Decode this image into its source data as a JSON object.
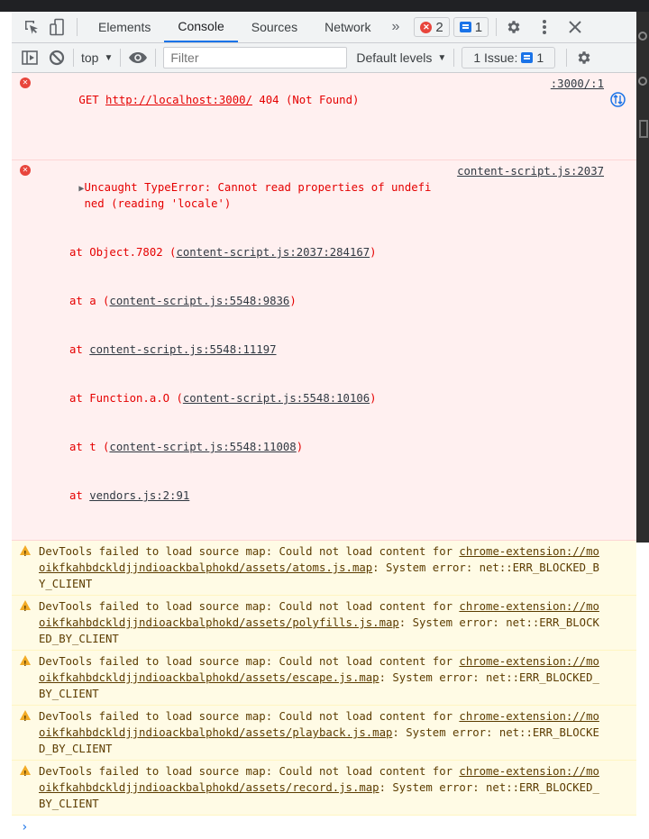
{
  "tabbar": {
    "tabs": [
      {
        "label": "Elements",
        "active": false
      },
      {
        "label": "Console",
        "active": true
      },
      {
        "label": "Sources",
        "active": false
      },
      {
        "label": "Network",
        "active": false
      }
    ],
    "more_tabs": "»",
    "error_count": "2",
    "message_count": "1"
  },
  "toolbar": {
    "context": "top",
    "filter_placeholder": "Filter",
    "levels": "Default levels",
    "issues_label": "1 Issue:",
    "issues_count": "1"
  },
  "messages": [
    {
      "level": "error",
      "method": "GET",
      "url": "http://localhost:3000/",
      "status": "404 (Not Found)",
      "source": ":3000/:1"
    },
    {
      "level": "error",
      "text": "Uncaught TypeError: Cannot read properties of undefined (reading 'locale')",
      "source": "content-script.js:2037",
      "stack": [
        {
          "pre": "at Object.7802 (",
          "link": "content-script.js:2037:284167",
          "post": ")"
        },
        {
          "pre": "at a (",
          "link": "content-script.js:5548:9836",
          "post": ")"
        },
        {
          "pre": "at ",
          "link": "content-script.js:5548:11197",
          "post": ""
        },
        {
          "pre": "at Function.a.O (",
          "link": "content-script.js:5548:10106",
          "post": ")"
        },
        {
          "pre": "at t (",
          "link": "content-script.js:5548:11008",
          "post": ")"
        },
        {
          "pre": "at ",
          "link": "vendors.js:2:91",
          "post": ""
        }
      ]
    },
    {
      "level": "warning",
      "pre": "DevTools failed to load source map: Could not load content for ",
      "link": "chrome-extension://mooikfkahbdckldjjndioackbalphokd/assets/atoms.js.map",
      "post": ": System error: net::ERR_BLOCKED_BY_CLIENT"
    },
    {
      "level": "warning",
      "pre": "DevTools failed to load source map: Could not load content for ",
      "link": "chrome-extension://mooikfkahbdckldjjndioackbalphokd/assets/polyfills.js.map",
      "post": ": System error: net::ERR_BLOCKED_BY_CLIENT"
    },
    {
      "level": "warning",
      "pre": "DevTools failed to load source map: Could not load content for ",
      "link": "chrome-extension://mooikfkahbdckldjjndioackbalphokd/assets/escape.js.map",
      "post": ": System error: net::ERR_BLOCKED_BY_CLIENT"
    },
    {
      "level": "warning",
      "pre": "DevTools failed to load source map: Could not load content for ",
      "link": "chrome-extension://mooikfkahbdckldjjndioackbalphokd/assets/playback.js.map",
      "post": ": System error: net::ERR_BLOCKED_BY_CLIENT"
    },
    {
      "level": "warning",
      "pre": "DevTools failed to load source map: Could not load content for ",
      "link": "chrome-extension://mooikfkahbdckldjjndioackbalphokd/assets/record.js.map",
      "post": ": System error: net::ERR_BLOCKED_BY_CLIENT"
    }
  ],
  "prompt": "›"
}
